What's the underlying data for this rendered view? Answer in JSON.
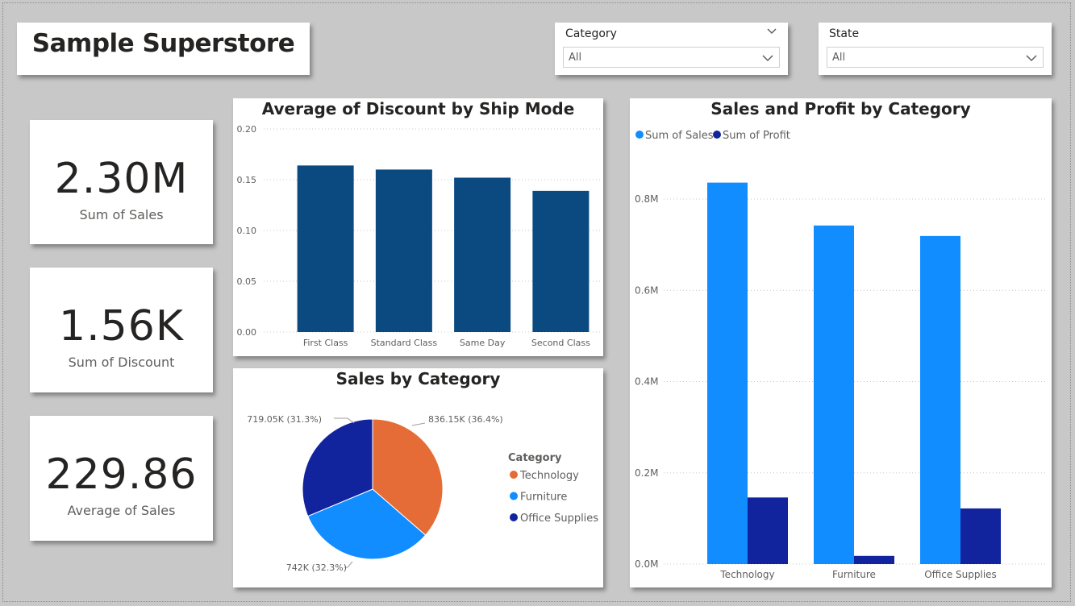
{
  "report": {
    "title": "Sample Superstore"
  },
  "slicers": [
    {
      "label": "Category",
      "value": "All"
    },
    {
      "label": "State",
      "value": "All"
    }
  ],
  "kpis": [
    {
      "value": "2.30M",
      "caption": "Sum of Sales"
    },
    {
      "value": "1.56K",
      "caption": "Sum of Discount"
    },
    {
      "value": "229.86",
      "caption": "Average of Sales"
    }
  ],
  "icons": {
    "slicer_header": "chevron-down-icon",
    "slicer_dropdown": "chevron-down-icon"
  },
  "colors": {
    "background": "#c8c8c8",
    "bar_dark_blue": "#0b4a80",
    "sales_blue": "#118dff",
    "profit_navy": "#12239e",
    "technology_orange": "#e66c37",
    "furniture_blue": "#118dff",
    "office_supplies_navy": "#12239e"
  },
  "chart_data": [
    {
      "type": "bar",
      "title": "Average of Discount by Ship Mode",
      "categories": [
        "First Class",
        "Standard Class",
        "Same Day",
        "Second Class"
      ],
      "values": [
        0.164,
        0.16,
        0.152,
        0.139
      ],
      "ylim": [
        0,
        0.2
      ],
      "yticks": [
        "0.00",
        "0.05",
        "0.10",
        "0.15",
        "0.20"
      ],
      "grid": true
    },
    {
      "type": "pie",
      "title": "Sales by Category",
      "legend_title": "Category",
      "legend_position": "right",
      "slices": [
        {
          "name": "Technology",
          "value": 836.15,
          "label": "836.15K (36.4%)"
        },
        {
          "name": "Furniture",
          "value": 742,
          "label": "742K (32.3%)"
        },
        {
          "name": "Office Supplies",
          "value": 719.05,
          "label": "719.05K (31.3%)"
        }
      ]
    },
    {
      "type": "bar",
      "title": "Sales and Profit by Category",
      "categories": [
        "Technology",
        "Furniture",
        "Office Supplies"
      ],
      "series": [
        {
          "name": "Sum of Sales",
          "values": [
            0.836,
            0.742,
            0.719
          ]
        },
        {
          "name": "Sum of Profit",
          "values": [
            0.146,
            0.018,
            0.122
          ]
        }
      ],
      "ylim": [
        0,
        0.85
      ],
      "yticks": [
        "0.0M",
        "0.2M",
        "0.4M",
        "0.6M",
        "0.8M"
      ],
      "legend_position": "top-left",
      "grid": true
    }
  ]
}
